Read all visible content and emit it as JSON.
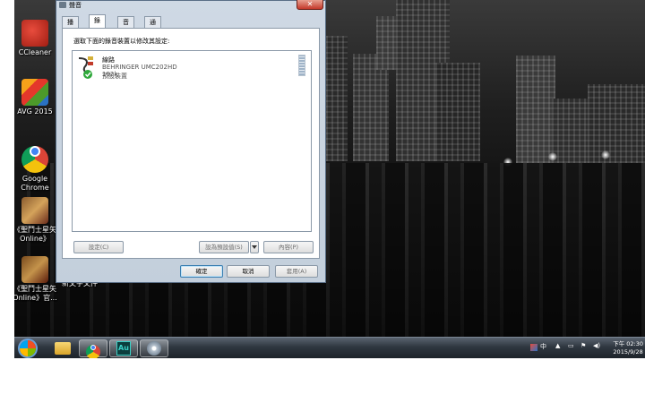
{
  "desktop": {
    "icons": [
      {
        "label": "CCleaner"
      },
      {
        "label": "AVG 2015"
      },
      {
        "label": "Google\nChrome"
      },
      {
        "label": "《聖鬥士星矢\nOnline》"
      },
      {
        "label": "《聖鬥士星矢\nOnline》官..."
      },
      {
        "label": "新文字文件"
      }
    ]
  },
  "dialog": {
    "title": "聲音",
    "close_label": "✕",
    "tabs": [
      {
        "label": "播放"
      },
      {
        "label": "錄製"
      },
      {
        "label": "音效"
      },
      {
        "label": "通訊"
      }
    ],
    "instruction": "選取下面的錄音裝置以修改其設定:",
    "device": {
      "name": "線路",
      "subtitle": "BEHRINGER UMC202HD 192k",
      "status": "預設裝置"
    },
    "buttons": {
      "configure": "設定(C)",
      "set_default": "設為預設值(S)",
      "properties": "內容(P)",
      "ok": "確定",
      "cancel": "取消",
      "apply": "套用(A)"
    }
  },
  "taskbar": {
    "apps": [
      {
        "icon": "start-orb-icon"
      },
      {
        "icon": "file-explorer-icon"
      },
      {
        "icon": "chrome-icon"
      },
      {
        "icon": "audition-icon",
        "label": "Au"
      },
      {
        "icon": "disc-icon"
      }
    ],
    "tray": {
      "ime": "中",
      "clock_time": "下午 02:30",
      "clock_date": "2015/9/28"
    }
  },
  "colors": {
    "accent": "#3c7fb1",
    "close": "#c4392b",
    "check": "#2fa83b"
  }
}
